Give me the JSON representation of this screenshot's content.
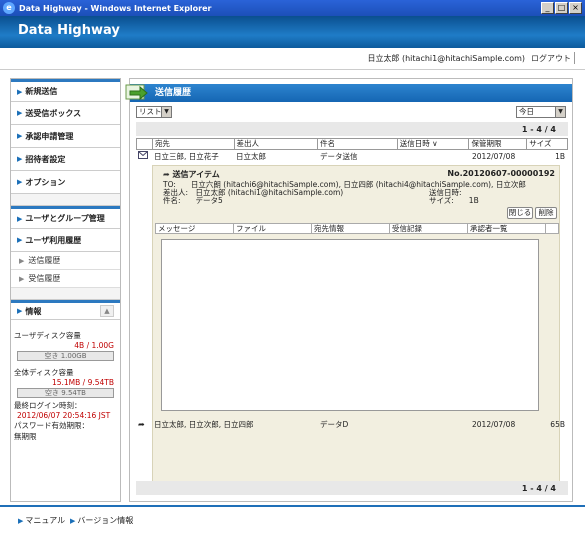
{
  "window": {
    "title": "Data Highway - Windows Internet Explorer",
    "ie_icon": "e",
    "controls": [
      "_",
      "□",
      "×"
    ]
  },
  "app": {
    "brand": "Data Highway"
  },
  "userbar": {
    "user": "日立太郎 (hitachi1@hitachiSample.com)",
    "logout": "ログアウト"
  },
  "nav": {
    "items": [
      "新規送信",
      "送受信ボックス",
      "承認申請管理",
      "招待者設定",
      "オプション"
    ],
    "admin_items": [
      "ユーザとグループ管理",
      "ユーザ利用履歴"
    ],
    "sub_items": [
      "送信履歴",
      "受信履歴"
    ]
  },
  "info": {
    "title": "情報",
    "user_disk_label": "ユーザディスク容量",
    "user_disk_value": "4B / 1.00G",
    "user_disk_free": "空き 1.00GB",
    "total_disk_label": "全体ディスク容量",
    "total_disk_value": "15.1MB / 9.54TB",
    "total_disk_free": "空き 9.54TB",
    "last_login_label": "最終ログイン時刻：",
    "last_login_value": "2012/06/07 20:54:16 JST",
    "pw_label": "パスワード有効期限：",
    "pw_value": "無期限"
  },
  "main": {
    "title": "送信履歴",
    "list_select": "リスト",
    "period_select": "今日",
    "pager": "1 - 4 / 4",
    "columns": [
      "宛先",
      "差出人",
      "件名",
      "送信日時 ∨",
      "保管期限",
      "サイズ"
    ],
    "rows": [
      {
        "to": "日立三郎, 日立花子",
        "from": "日立太郎",
        "subject": "データ送信",
        "sent": "",
        "expire": "2012/07/08",
        "size": "1B"
      },
      {
        "to": "日立太郎, 日立次郎, 日立四郎",
        "from": "",
        "subject": "データD",
        "sent": "",
        "expire": "2012/07/08",
        "size": "65B"
      }
    ],
    "detail": {
      "title": "送信アイテム",
      "number": "No.20120607-00000192",
      "to_line": "TO:　　日立六朗 (hitachi6@hitachiSample.com), 日立四郎 (hitachi4@hitachiSample.com), 日立次郎",
      "from_line": "差出人:　日立太郎 (hitachi1@hitachiSample.com)",
      "subject_line": "件名:　　データ5",
      "sent_label": "送信日時:",
      "size_line": "サイズ:　　1B",
      "close_button": "閉じる",
      "delete_button": "削除",
      "tabs": [
        "メッセージ",
        "ファイル",
        "宛先情報",
        "受信記録",
        "承認者一覧"
      ]
    }
  },
  "footer": {
    "manual": "マニュアル",
    "version": "バージョン情報"
  },
  "colors": {
    "brand_blue": "#1f7cc7",
    "accent_red": "#c00000"
  },
  "icons": {
    "mail": "envelope-icon",
    "send": "send-arrow-icon"
  }
}
